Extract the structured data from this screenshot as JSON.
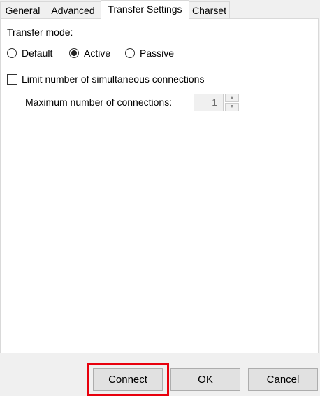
{
  "tabs": [
    {
      "label": "General"
    },
    {
      "label": "Advanced"
    },
    {
      "label": "Transfer Settings"
    },
    {
      "label": "Charset"
    }
  ],
  "transfer_mode": {
    "label": "Transfer mode:",
    "options": [
      {
        "label": "Default",
        "selected": false
      },
      {
        "label": "Active",
        "selected": true
      },
      {
        "label": "Passive",
        "selected": false
      }
    ]
  },
  "limit": {
    "label": "Limit number of simultaneous connections",
    "checked": false
  },
  "max_connections": {
    "label": "Maximum number of connections:",
    "value": "1",
    "up": "▲",
    "down": "▼"
  },
  "buttons": {
    "connect": "Connect",
    "ok": "OK",
    "cancel": "Cancel"
  },
  "colors": {
    "highlight": "#e8000d"
  }
}
